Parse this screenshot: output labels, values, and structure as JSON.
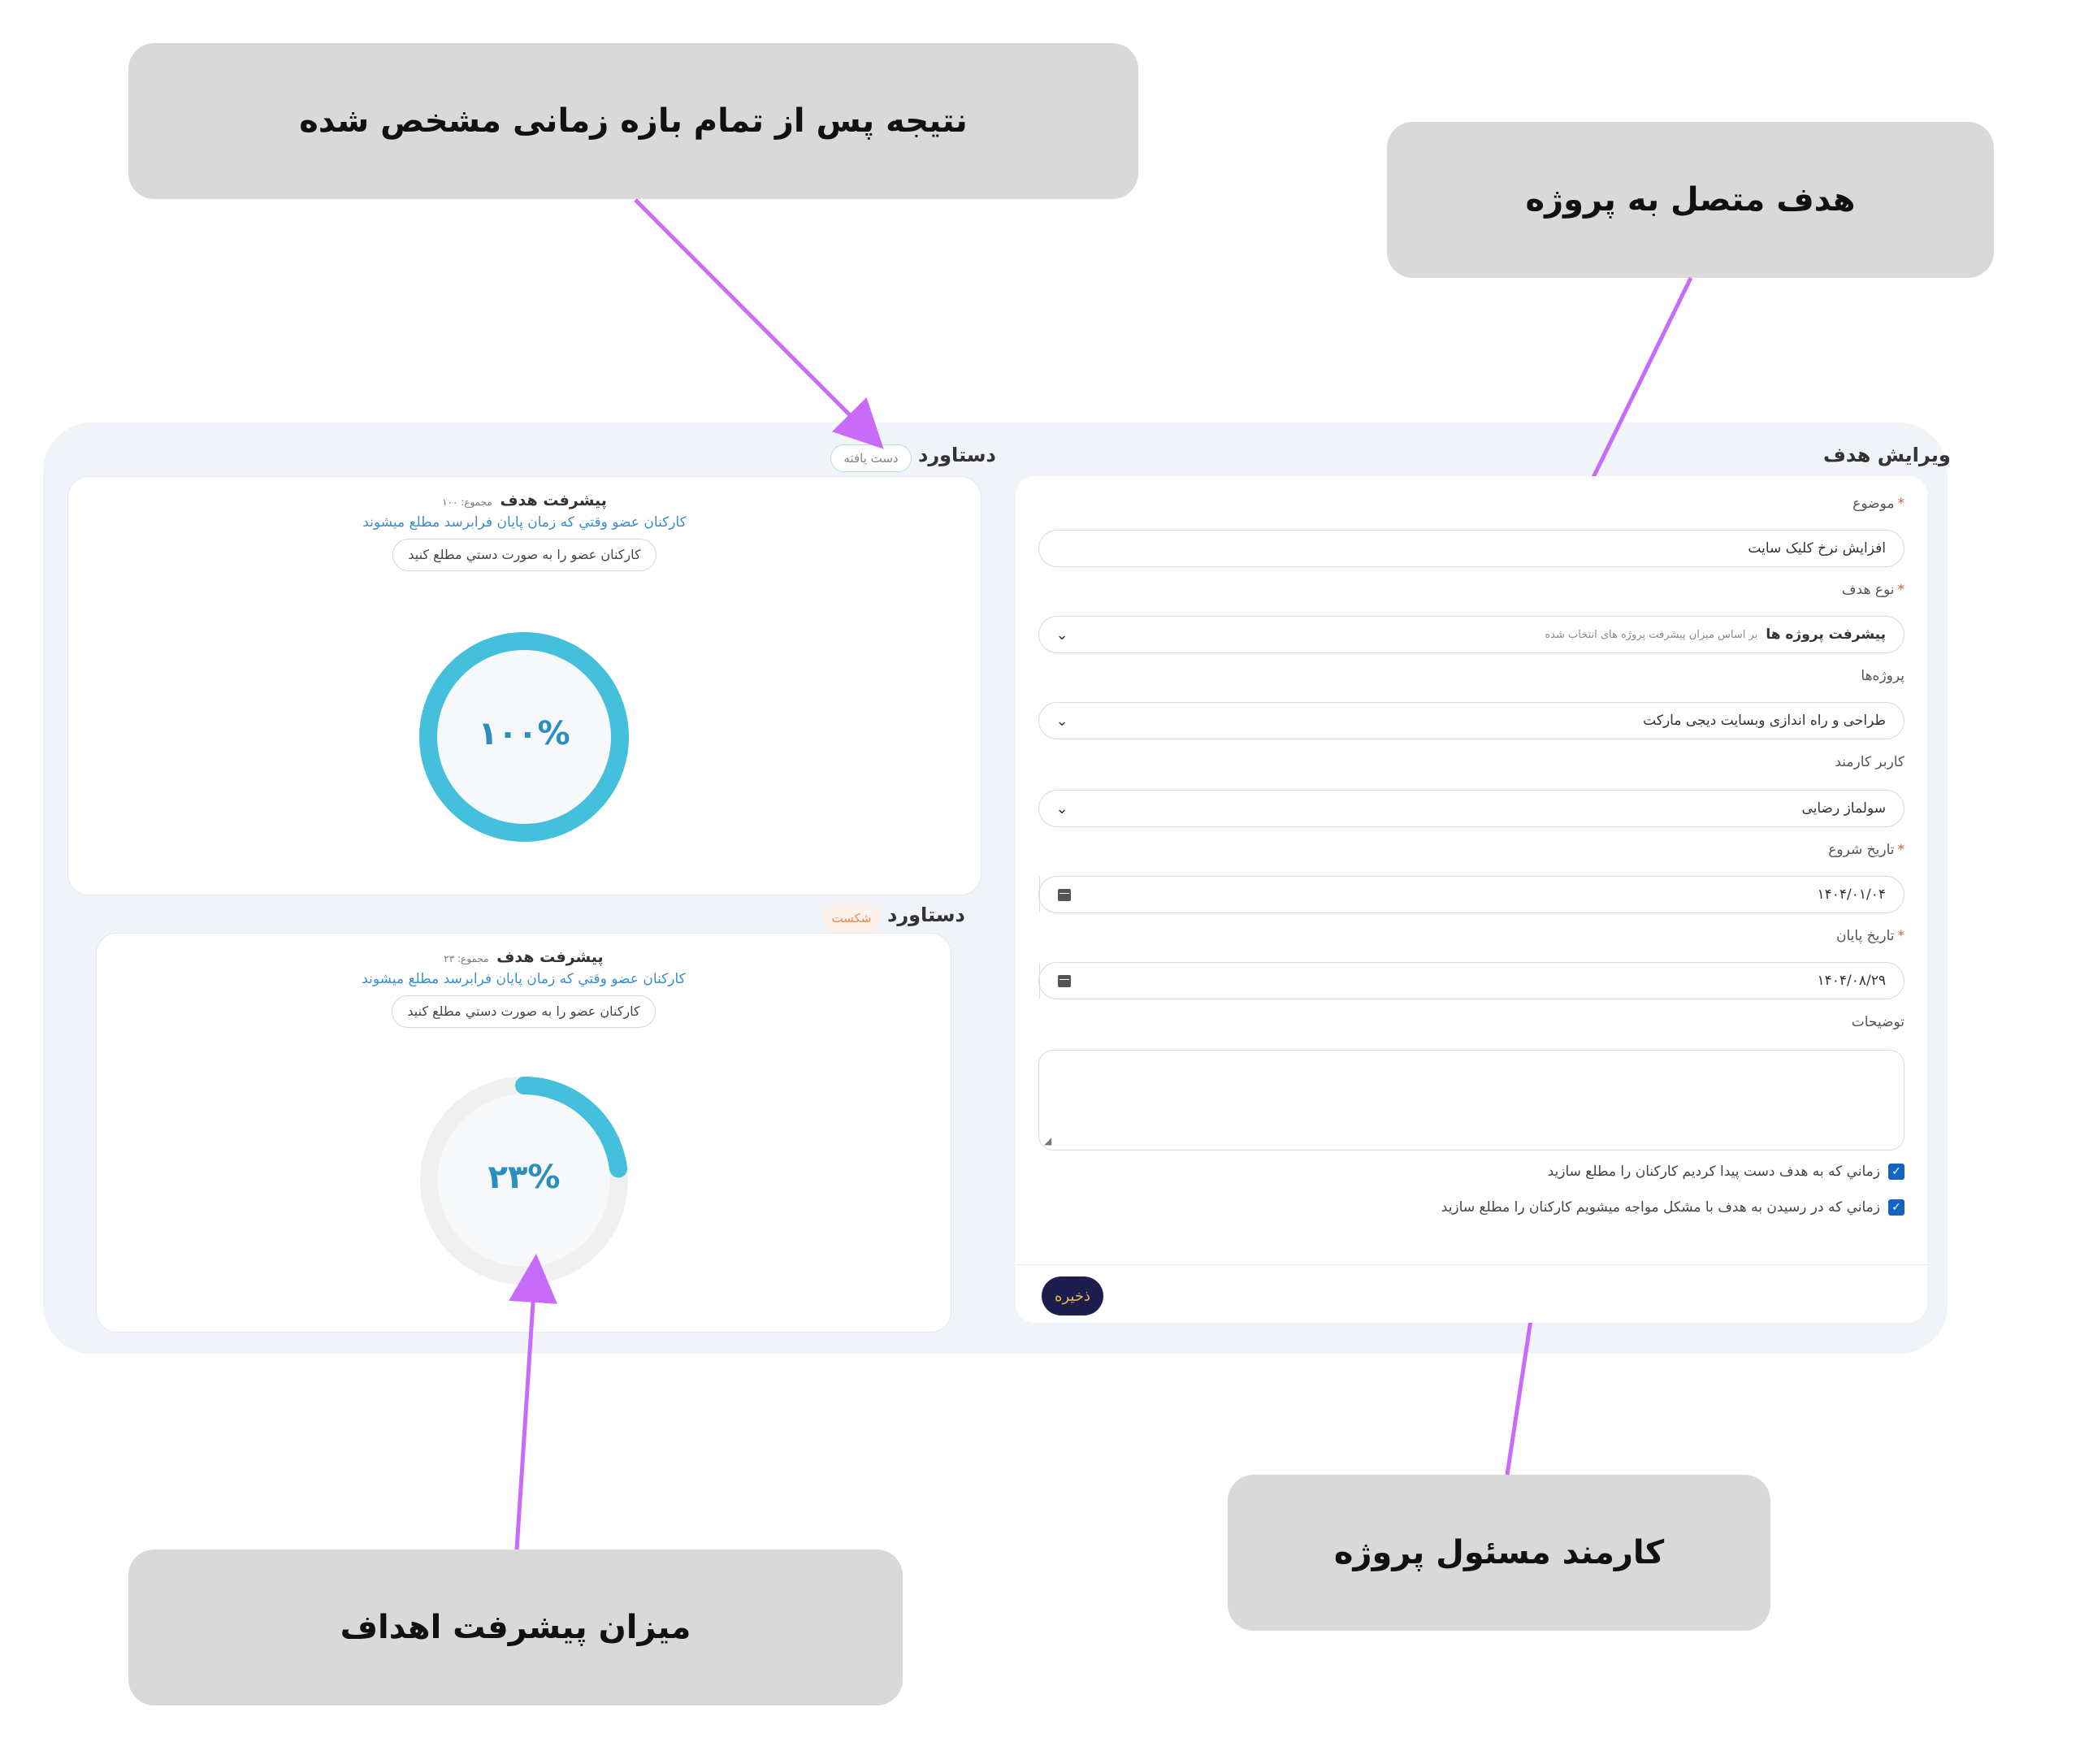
{
  "callouts": {
    "result_after_period": "نتیجه پس از تمام بازه زمانی مشخص شده",
    "goal_linked_project": "هدف متصل به پروژه",
    "project_responsible": "کارمند مسئول پروژه",
    "goal_progress_rate": "میزان پیشرفت اهداف"
  },
  "achievement_top": {
    "title": "دستاورد",
    "badge": "دست یافته",
    "progress_label": "پیشرفت هدف",
    "total_label": "مجموع: ۱۰۰",
    "notice": "کارکنان عضو وقتي که زمان پايان فرابرسد مطلع ميشوند",
    "manual_button": "کارکنان عضو را به صورت دستي مطلع کنيد",
    "percent_text": "۱۰۰%",
    "percent_value": 100
  },
  "achievement_bottom": {
    "title": "دستاورد",
    "badge": "شکست",
    "progress_label": "پیشرفت هدف",
    "total_label": "مجموع: ۲۳",
    "notice": "کارکنان عضو وقتي که زمان پايان فرابرسد مطلع ميشوند",
    "manual_button": "کارکنان عضو را به صورت دستي مطلع کنيد",
    "percent_text": "۲۳%",
    "percent_value": 23
  },
  "form": {
    "title": "ویرایش هدف",
    "subject_label": "موضوع",
    "subject_value": "افزایش نرخ کلیک سایت",
    "goal_type_label": "نوع هدف",
    "goal_type_value": "پیشرفت پروژه ها",
    "goal_type_hint": "بر اساس میزان پیشرفت پروژه های انتخاب شده",
    "projects_label": "پروژه‌ها",
    "projects_value": "طراحی و راه اندازی وبسایت دیجی مارکت",
    "employee_label": "کاربر کارمند",
    "employee_value": "سولماز رضایی",
    "start_date_label": "تاریخ شروع",
    "start_date_value": "۱۴۰۴/۰۱/۰۴",
    "end_date_label": "تاریخ پایان",
    "end_date_value": "۱۴۰۴/۰۸/۲۹",
    "description_label": "توضیحات",
    "check_achieved": "زماني که به هدف دست پيدا کرديم کارکنان را مطلع سازيد",
    "check_problem": "زماني که در رسيدن به هدف با مشکل مواجه ميشويم کارکنان را مطلع سازيد",
    "save_button": "ذخیره",
    "required_mark": "*",
    "chevron_glyph": "⌄",
    "check_glyph": "✓"
  },
  "colors": {
    "ring": "#45c0dc",
    "ring_track": "#f0f0f0",
    "arrow": "#c86bfa",
    "save_bg": "#1e1e4e",
    "save_text": "#e8b84a"
  }
}
